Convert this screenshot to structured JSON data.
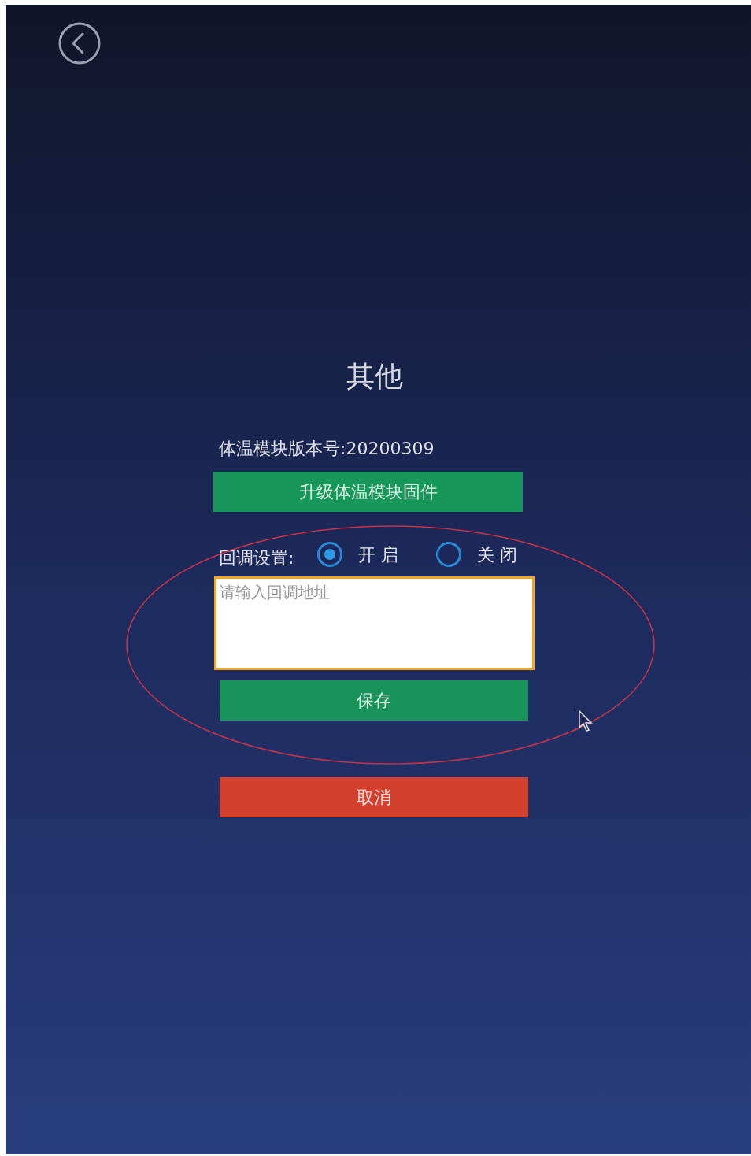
{
  "title": "其他",
  "version_label": "体温模块版本号:20200309",
  "upgrade_button": "升级体温模块固件",
  "callback": {
    "label": "回调设置:",
    "options": [
      {
        "label": "开 启",
        "selected": true
      },
      {
        "label": "关 闭",
        "selected": false
      }
    ]
  },
  "callback_url": {
    "placeholder": "请输入回调地址"
  },
  "buttons": [
    {
      "label": "保存",
      "kind": "save"
    },
    {
      "label": "取消",
      "kind": "cancel"
    }
  ]
}
